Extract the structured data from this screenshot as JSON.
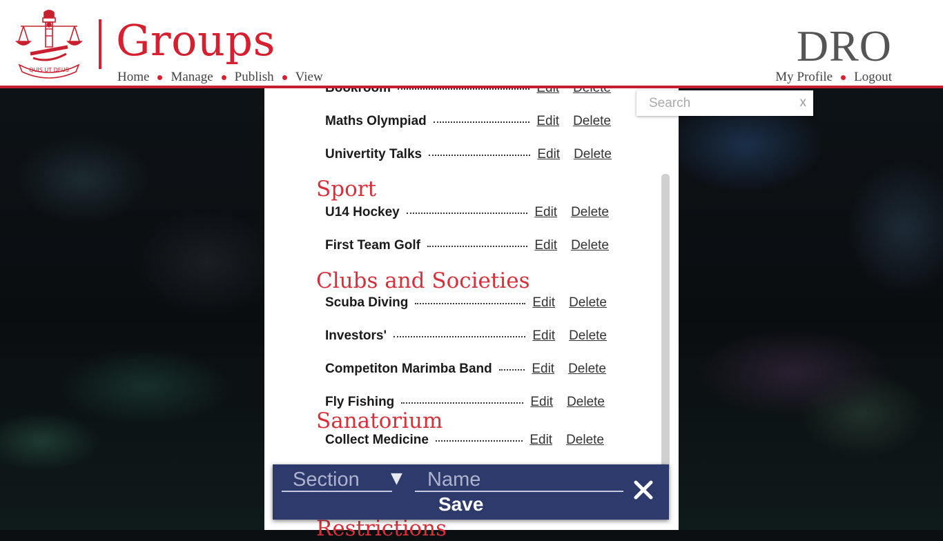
{
  "header": {
    "title": "Groups",
    "brand": "DRO",
    "crest_motto": "QUIS UT DEUS",
    "nav": [
      "Home",
      "Manage",
      "Publish",
      "View"
    ],
    "user_nav": [
      "My Profile",
      "Logout"
    ]
  },
  "search": {
    "placeholder": "Search",
    "clear_label": "x"
  },
  "sections": [
    {
      "heading": "",
      "items": [
        {
          "name": "Bookroom",
          "edit": "Edit",
          "delete": "Delete"
        },
        {
          "name": "Maths Olympiad",
          "edit": "Edit",
          "delete": "Delete"
        },
        {
          "name": "Univertity Talks",
          "edit": "Edit",
          "delete": "Delete"
        }
      ]
    },
    {
      "heading": "Sport",
      "items": [
        {
          "name": "U14 Hockey",
          "edit": "Edit",
          "delete": "Delete"
        },
        {
          "name": "First Team Golf",
          "edit": "Edit",
          "delete": "Delete"
        }
      ]
    },
    {
      "heading": "Clubs and Societies",
      "items": [
        {
          "name": "Scuba Diving",
          "edit": "Edit",
          "delete": "Delete"
        },
        {
          "name": "Investors'",
          "edit": "Edit",
          "delete": "Delete"
        },
        {
          "name": "Competiton Marimba Band",
          "edit": "Edit",
          "delete": "Delete"
        },
        {
          "name": "Fly Fishing",
          "edit": "Edit",
          "delete": "Delete"
        }
      ]
    },
    {
      "heading": "Sanatorium",
      "items": [
        {
          "name": "Collect Medicine",
          "edit": "Edit",
          "delete": "Delete"
        }
      ]
    },
    {
      "heading": "Restrictions",
      "items": []
    }
  ],
  "form": {
    "section_placeholder": "Section",
    "name_placeholder": "Name",
    "save_label": "Save"
  },
  "colors": {
    "brand_red": "#d7202f",
    "form_navy": "#2d3a6b"
  }
}
